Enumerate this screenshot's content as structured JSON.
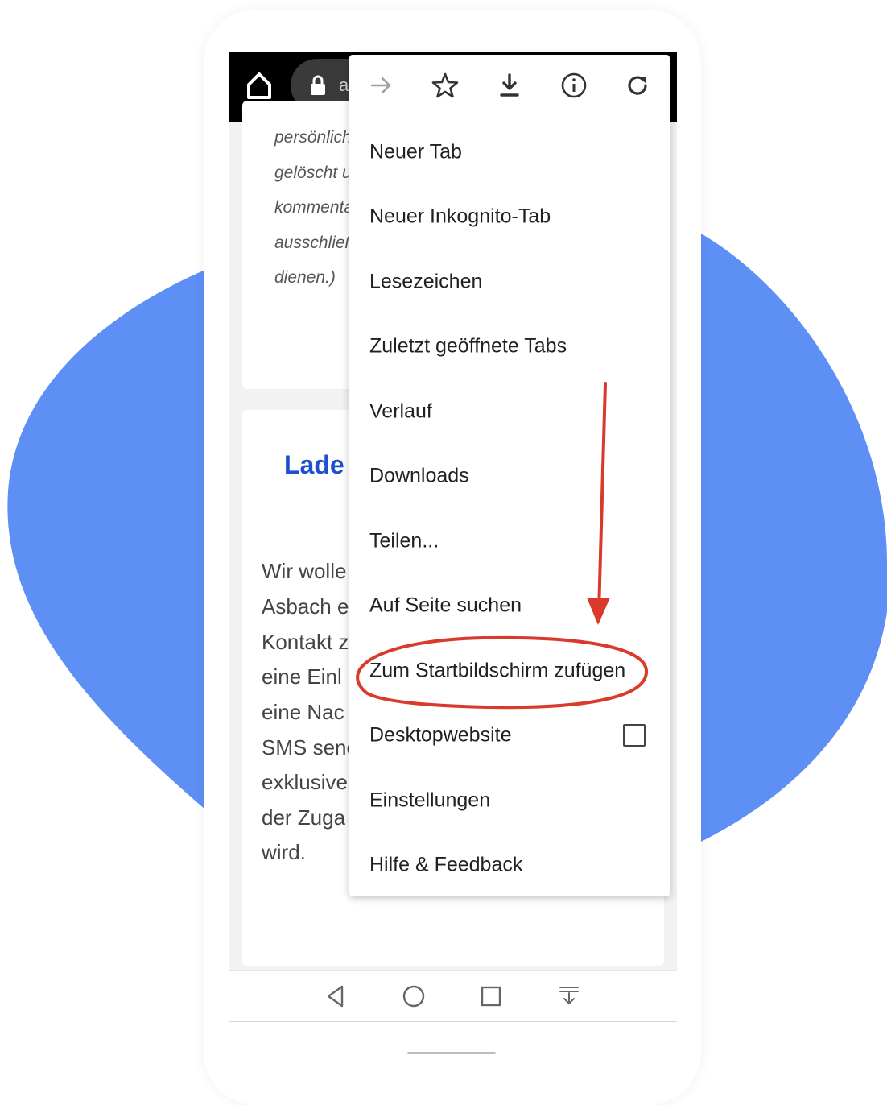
{
  "colors": {
    "blob": "#5e8ff5",
    "link_blue": "#1f4fd1",
    "annotation_red": "#d93a2b"
  },
  "browser": {
    "url_partial": "a"
  },
  "page": {
    "card1_lines": [
      "persönliche",
      "gelöscht u",
      "kommenta",
      "ausschließ",
      "dienen.)"
    ],
    "card2_heading": "Lade",
    "card2_lines": [
      "Wir wolle",
      "Asbach e",
      "Kontakt z",
      "eine Einl",
      "eine Nac",
      "SMS senc",
      "exklusive",
      "der Zuga",
      "wird."
    ]
  },
  "menu": {
    "toolbar_icons": [
      "forward-icon",
      "star-icon",
      "download-icon",
      "info-icon",
      "reload-icon"
    ],
    "items": [
      {
        "label": "Neuer Tab"
      },
      {
        "label": "Neuer Inkognito-Tab"
      },
      {
        "label": "Lesezeichen"
      },
      {
        "label": "Zuletzt geöffnete Tabs"
      },
      {
        "label": "Verlauf"
      },
      {
        "label": "Downloads"
      },
      {
        "label": "Teilen..."
      },
      {
        "label": "Auf Seite suchen"
      },
      {
        "label": "Zum Startbildschirm zufügen"
      },
      {
        "label": "Desktopwebsite"
      },
      {
        "label": "Einstellungen"
      },
      {
        "label": "Hilfe & Feedback"
      }
    ]
  },
  "navbar": {
    "icons": [
      "back-icon",
      "home-circle-icon",
      "recents-icon",
      "download-tray-icon"
    ]
  }
}
